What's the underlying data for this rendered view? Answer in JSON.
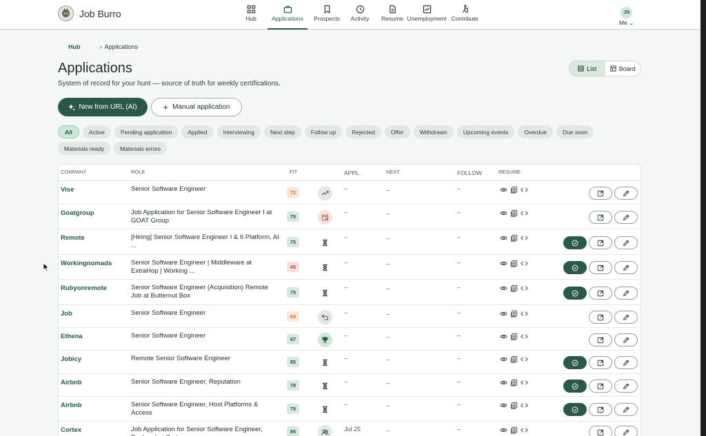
{
  "app": {
    "name": "Job Burro"
  },
  "nav": {
    "items": [
      {
        "label": "Hub",
        "icon": "grid-icon",
        "active": false
      },
      {
        "label": "Applications",
        "icon": "briefcase-icon",
        "active": true
      },
      {
        "label": "Prospects",
        "icon": "bookmark-icon",
        "active": false
      },
      {
        "label": "Activity",
        "icon": "history-icon",
        "active": false
      },
      {
        "label": "Resume",
        "icon": "document-icon",
        "active": false
      },
      {
        "label": "Unemployment",
        "icon": "chart-icon",
        "active": false
      },
      {
        "label": "Contribute",
        "icon": "hiker-icon",
        "active": false
      }
    ],
    "user_initials": "JN",
    "user_label": "Me"
  },
  "breadcrumb": {
    "home": "Hub",
    "current": "Applications"
  },
  "header": {
    "title": "Applications",
    "subtitle": "System of record for your hunt — source of truth for weekly certifications.",
    "view_list": "List",
    "view_board": "Board"
  },
  "actions": {
    "new_from_url": "New from URL (AI)",
    "manual": "Manual application"
  },
  "filters": [
    "All",
    "Active",
    "Pending application",
    "Applied",
    "Interviewing",
    "Next step",
    "Follow up",
    "Rejected",
    "Offer",
    "Withdrawn",
    "Upcoming events",
    "Overdue",
    "Due soon",
    "Materials ready",
    "Materials errors"
  ],
  "table": {
    "columns": {
      "company": "COMPANY",
      "role": "ROLE",
      "fit": "FIT",
      "appl": "APPL.",
      "next": "NEXT",
      "follow": "FOLLOW",
      "resume": "RESUME"
    },
    "rows": [
      {
        "company": "Vise",
        "role": "Senior Software Engineer",
        "fit": "72",
        "fit_color": "orange",
        "status": "trend-icon",
        "appl": "–",
        "next": "–",
        "follow": "–",
        "check": false
      },
      {
        "company": "Goatgroup",
        "role": "Job Application for Senior Software Engineer I at GOAT Group",
        "fit": "75",
        "fit_color": "green",
        "status": "calendar-icon",
        "appl": "–",
        "next": "–",
        "follow": "–",
        "check": false
      },
      {
        "company": "Remote",
        "role": "[Hiring] Senior Software Engineer I & II Platform, AI ...",
        "fit": "75",
        "fit_color": "green",
        "status": "hourglass-icon",
        "appl": "–",
        "next": "–",
        "follow": "–",
        "check": true
      },
      {
        "company": "Workingnomads",
        "role": "Senior Software Engineer | Middleware at ExtraHop | Working ...",
        "fit": "45",
        "fit_color": "red",
        "status": "hourglass-icon",
        "appl": "–",
        "next": "–",
        "follow": "–",
        "check": true
      },
      {
        "company": "Rubyonremote",
        "role": "Senior Software Engineer (Acquisition) Remote Job at Butternut Box",
        "fit": "75",
        "fit_color": "green",
        "status": "hourglass-icon",
        "appl": "–",
        "next": "–",
        "follow": "–",
        "check": true
      },
      {
        "company": "Job",
        "role": "Senior Software Engineer",
        "fit": "65",
        "fit_color": "orange",
        "status": "undo-icon",
        "appl": "–",
        "next": "–",
        "follow": "–",
        "check": false
      },
      {
        "company": "Ethena",
        "role": "Senior Software Engineer",
        "fit": "87",
        "fit_color": "green",
        "status": "trophy-icon",
        "appl": "–",
        "next": "–",
        "follow": "–",
        "check": false
      },
      {
        "company": "Jobicy",
        "role": "Remote Senior Software Engineer",
        "fit": "85",
        "fit_color": "green",
        "status": "hourglass-icon",
        "appl": "–",
        "next": "–",
        "follow": "–",
        "check": true
      },
      {
        "company": "Airbnb",
        "role": "Senior Software Engineer, Reputation",
        "fit": "78",
        "fit_color": "green",
        "status": "hourglass-icon",
        "appl": "–",
        "next": "–",
        "follow": "–",
        "check": true
      },
      {
        "company": "Airbnb",
        "role": "Senior Software Engineer, Host Platforms & Access",
        "fit": "75",
        "fit_color": "green",
        "status": "hourglass-icon",
        "appl": "–",
        "next": "–",
        "follow": "–",
        "check": true
      },
      {
        "company": "Cortex",
        "role": "Job Application for Senior Software Engineer, Backend at Cortex",
        "fit": "85",
        "fit_color": "green",
        "status": "people-icon",
        "appl": "Jul 25",
        "next": "–",
        "follow": "–",
        "check": false
      }
    ]
  }
}
